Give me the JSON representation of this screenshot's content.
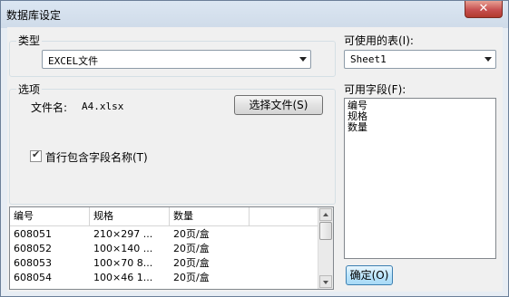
{
  "window": {
    "title": "数据库设定",
    "close_glyph": "✕"
  },
  "type_group": {
    "label": "类型",
    "selected": "EXCEL文件"
  },
  "options_group": {
    "label": "选项",
    "file_label": "文件名:",
    "file_name": "A4.xlsx",
    "choose_file_button": "选择文件(S)",
    "first_row_checkbox_label": "首行包含字段名称(T)",
    "first_row_checked": true
  },
  "tables": {
    "label": "可使用的表(I):",
    "selected": "Sheet1"
  },
  "fields": {
    "label": "可用字段(F):",
    "items": [
      "编号",
      "规格",
      "数量"
    ]
  },
  "ok_button": "确定(O)",
  "preview": {
    "columns": [
      "编号",
      "规格",
      "数量"
    ],
    "rows": [
      [
        "608051",
        "210×297 ...",
        "20页/盒"
      ],
      [
        "608052",
        "100×140 ...",
        "20页/盒"
      ],
      [
        "608053",
        "100×70 8...",
        "20页/盒"
      ],
      [
        "608054",
        "100×46 1...",
        "20页/盒"
      ]
    ]
  }
}
